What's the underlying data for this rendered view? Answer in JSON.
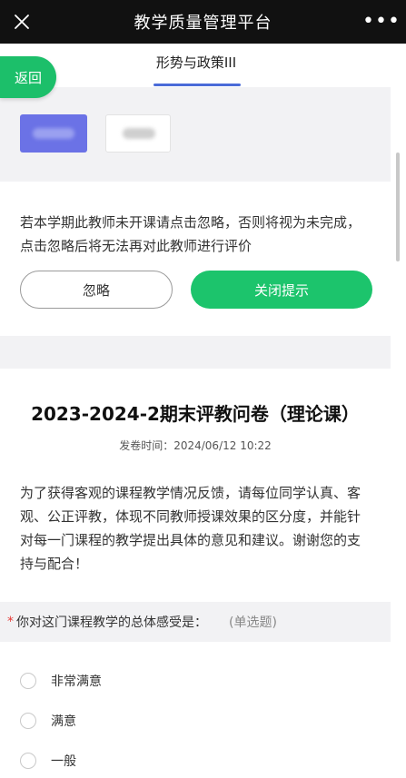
{
  "header": {
    "title": "教学质量管理平台",
    "more_icon": "more-dots-icon",
    "close_icon": "close-icon"
  },
  "tab": {
    "course_name": "形势与政策III"
  },
  "back_button": {
    "label": "返回"
  },
  "notice": {
    "text": "若本学期此教师未开课请点击忽略，否则将视为未完成，点击忽略后将无法再对此教师进行评价",
    "ignore_label": "忽略",
    "close_tip_label": "关闭提示"
  },
  "survey": {
    "title": "2023-2024-2期末评教问卷（理论课）",
    "time": "发卷时间：2024/06/12 10:22",
    "intro": "为了获得客观的课程教学情况反馈，请每位同学认真、客观、公正评教，体现不同教师授课效果的区分度，并能针对每一门课程的教学提出具体的意见和建议。谢谢您的支持与配合！"
  },
  "question": {
    "required_mark": "*",
    "text": "你对这门课程教学的总体感受是：",
    "type": "(单选题)",
    "options": [
      "非常满意",
      "满意",
      "一般"
    ]
  },
  "colors": {
    "accent_green": "#1cc46c",
    "teacher_selected": "#6b72e6",
    "tab_underline": "#4a6bd8",
    "required_red": "#e53935"
  }
}
